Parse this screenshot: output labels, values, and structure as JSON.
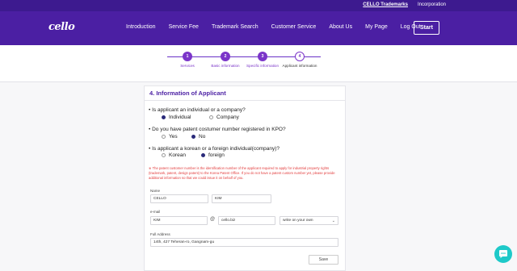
{
  "top_links": {
    "trademarks": "CELLO Trademarks",
    "incorporation": "Incorporation"
  },
  "brand": {
    "logo": "cello"
  },
  "menu": [
    "Introduction",
    "Service Fee",
    "Trademark Search",
    "Customer Service",
    "About Us",
    "My Page",
    "Log Out"
  ],
  "start_label": "Start",
  "steps": [
    {
      "num": "1",
      "label": "Services"
    },
    {
      "num": "2",
      "label": "Basic information"
    },
    {
      "num": "3",
      "label": "Specific information"
    },
    {
      "num": "4",
      "label": "Applicant information"
    }
  ],
  "section_title": "4. Information of Applicant",
  "q1": {
    "text": "Is applicant an individual or a company?",
    "opt1": "Individual",
    "opt2": "Company"
  },
  "q2": {
    "text": "Do you have patent costumer number registered in KPO?",
    "opt1": "Yes",
    "opt2": "No"
  },
  "q3": {
    "text": "Is applicant a korean or a foreign individual(company)?",
    "opt1": "Korean",
    "opt2": "foreign"
  },
  "notice": "※ The patent customer number is the identification number of the applicant required to apply for industrial property rights (trademark, patent, design patent) to the Korea Patent Office. If you do not have a patent custom number yet, please provide additional information so that we could issue it on behalf of you.",
  "form": {
    "name_label": "Name",
    "first_name": "CELLO",
    "last_name": "KIM",
    "email_label": "e-mail",
    "email_user": "KIM",
    "at": "@",
    "email_domain": "cello.biz",
    "email_select": "write on your own",
    "address_label": "Full Address",
    "address": "14th, 427 Teheran-ro, Gangnam-gu",
    "save_label": "Save"
  },
  "colors": {
    "primary": "#4b1fa3",
    "accent": "#7b35c9",
    "chat": "#1ec9c9",
    "notice": "#e23c3c"
  }
}
